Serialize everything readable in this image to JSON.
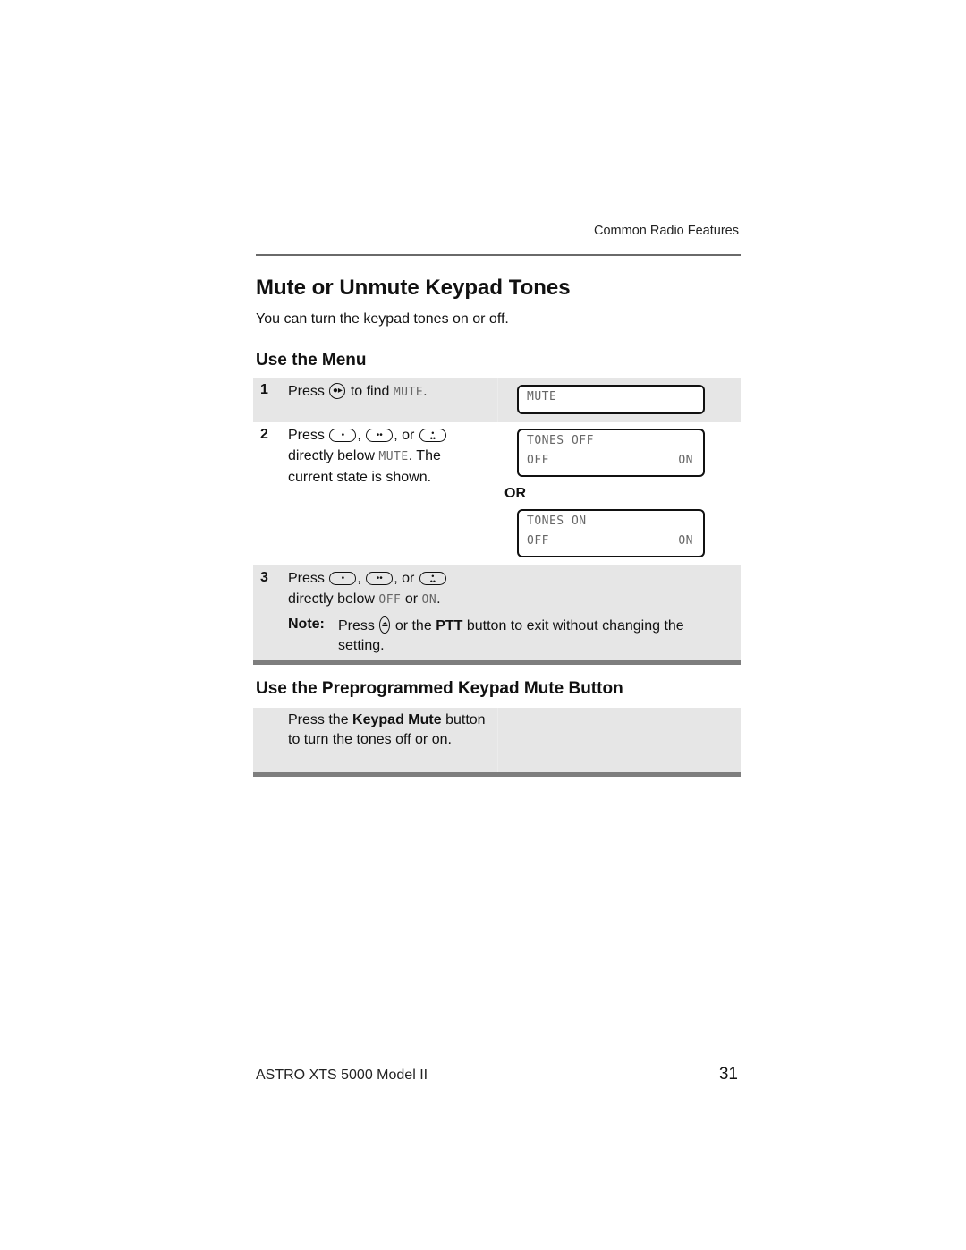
{
  "header": {
    "running_head": "Common Radio Features"
  },
  "title": "Mute or Unmute Keypad Tones",
  "intro": "You can turn the keypad tones on or off.",
  "section_menu": {
    "heading": "Use the Menu",
    "steps": [
      {
        "number": "1",
        "press": "Press",
        "after_icon": "to find",
        "lcd_word": "MUTE",
        "end": ".",
        "icon": "navigation-right-key-icon",
        "display": {
          "line1": "MUTE"
        }
      },
      {
        "number": "2",
        "press": "Press",
        "sep1": ",",
        "sep2": ", or",
        "line2_pre": "directly below",
        "lcd_word": "MUTE",
        "line2_post": ". The",
        "line3": "current state is shown.",
        "icons": [
          "softkey-one-dot-icon",
          "softkey-two-dot-icon",
          "softkey-three-dot-icon"
        ],
        "displays": [
          {
            "line1": "TONES OFF",
            "left": "OFF",
            "right": "ON"
          },
          {
            "line1": "TONES ON",
            "left": "OFF",
            "right": "ON"
          }
        ],
        "or_label": "OR"
      },
      {
        "number": "3",
        "press": "Press",
        "sep1": ",",
        "sep2": ", or",
        "line2_pre": "directly below",
        "lcd_off": "OFF",
        "or_word": "or",
        "lcd_on": "ON",
        "end": ".",
        "icons": [
          "softkey-one-dot-icon",
          "softkey-two-dot-icon",
          "softkey-three-dot-icon"
        ]
      }
    ],
    "note": {
      "label": "Note:",
      "press": "Press",
      "mid": "or the",
      "bold": "PTT",
      "rest": "button to exit without changing the setting.",
      "icon": "home-key-icon"
    }
  },
  "section_button": {
    "heading": "Use the Preprogrammed Keypad Mute Button",
    "pre": "Press the",
    "bold": "Keypad Mute",
    "post": "button to turn the tones off or on."
  },
  "footer": {
    "model": "ASTRO XTS 5000 Model II",
    "page_number": "31"
  }
}
